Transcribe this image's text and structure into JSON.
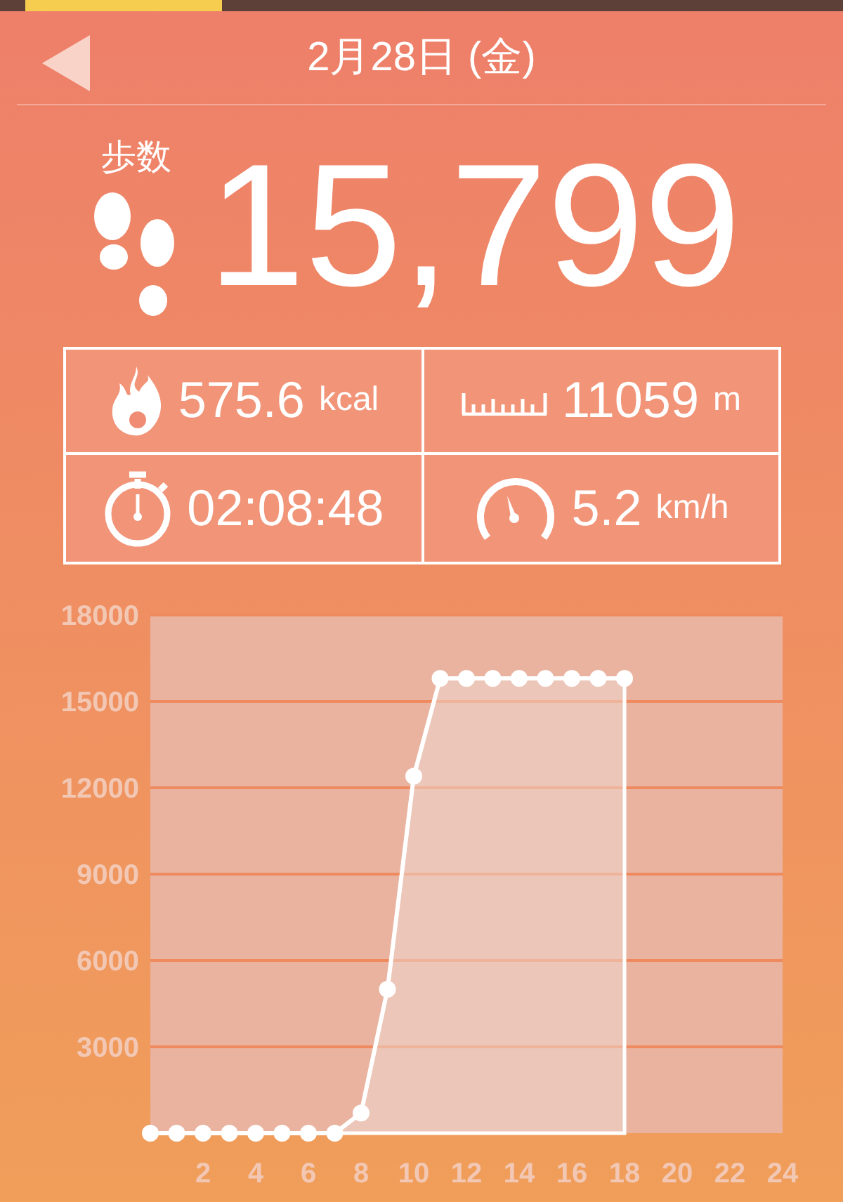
{
  "header": {
    "title": "2月28日 (金)"
  },
  "steps": {
    "label": "歩数",
    "value": "15,799"
  },
  "stats": [
    {
      "kind": "calories",
      "value": "575.6",
      "unit": "kcal"
    },
    {
      "kind": "distance",
      "value": "11059",
      "unit": "m"
    },
    {
      "kind": "time",
      "value": "02:08:48"
    },
    {
      "kind": "speed",
      "value": "5.2",
      "unit": "km/h"
    }
  ],
  "chart": {
    "chart_data": {
      "type": "line",
      "x": [
        0,
        1,
        2,
        3,
        4,
        5,
        6,
        7,
        8,
        9,
        10,
        11,
        12,
        13,
        14,
        15,
        16,
        17,
        18
      ],
      "grid": true,
      "series": [
        {
          "color": "#ffffff",
          "marker": true,
          "values": [
            0,
            0,
            0,
            0,
            0,
            0,
            0,
            0,
            700,
            5000,
            12400,
            15800,
            15800,
            15800,
            15800,
            15800,
            15800,
            15800,
            15800
          ]
        }
      ],
      "xlim": [
        0,
        24
      ],
      "ylim": [
        0,
        18000
      ],
      "xticks": [
        2,
        4,
        6,
        8,
        10,
        12,
        14,
        16,
        18,
        20,
        22,
        24
      ],
      "yticks": [
        3000,
        6000,
        9000,
        12000,
        15000,
        18000
      ]
    }
  }
}
